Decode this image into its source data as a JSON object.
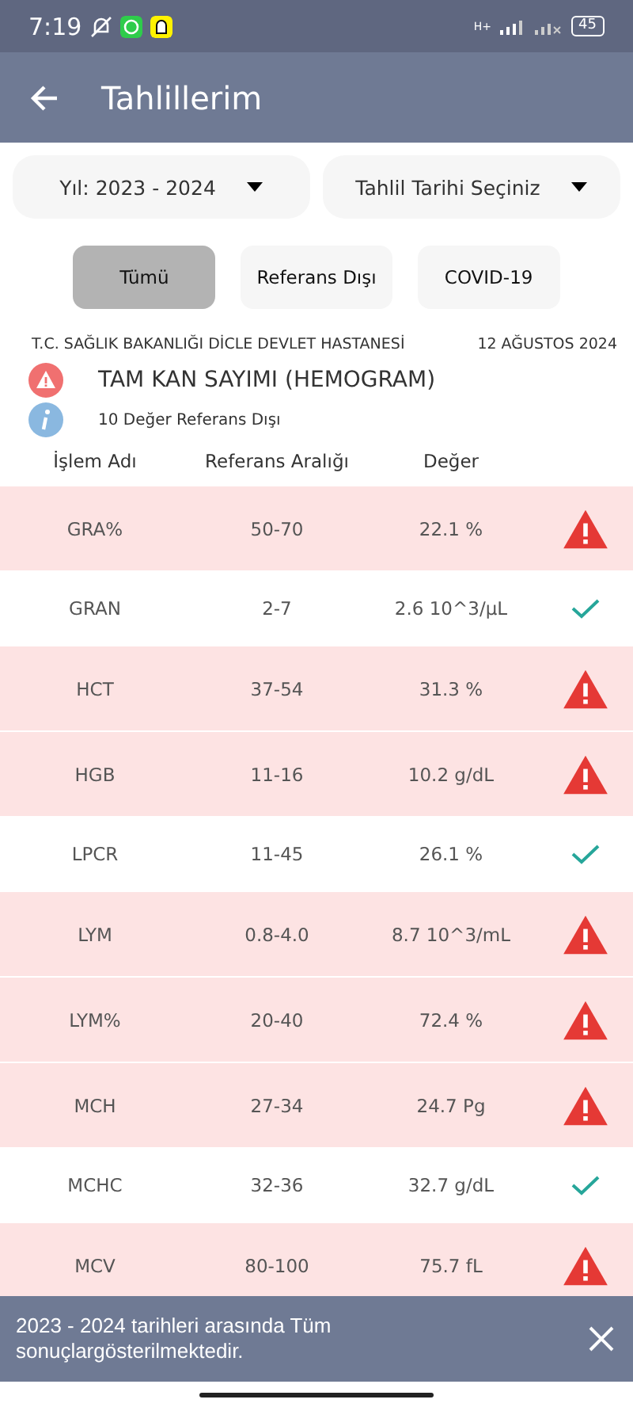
{
  "status_bar": {
    "time": "7:19",
    "network": "H+",
    "battery": "45"
  },
  "app_bar": {
    "title": "Tahlillerim"
  },
  "dropdowns": [
    {
      "value": "Yıl: 2023 - 2024"
    },
    {
      "value": "Tahlil Tarihi Seçiniz"
    }
  ],
  "filters": [
    {
      "label": "Tümü",
      "selected": true
    },
    {
      "label": "Referans Dışı",
      "selected": false
    },
    {
      "label": "COVID-19",
      "selected": false
    }
  ],
  "report": {
    "hospital": "T.C. SAĞLIK BAKANLIĞI DİCLE DEVLET HASTANESİ",
    "date": "12 AĞUSTOS 2024",
    "test_name": "TAM KAN SAYIMI (HEMOGRAM)",
    "summary": "10 Değer Referans Dışı"
  },
  "table": {
    "columns": [
      "İşlem Adı",
      "Referans Aralığı",
      "Değer"
    ],
    "rows": [
      {
        "name": "GRA%",
        "range": "50-70",
        "value": "22.1 %",
        "out_of_range": true
      },
      {
        "name": "GRAN",
        "range": "2-7",
        "value": "2.6 10^3/µL",
        "out_of_range": false
      },
      {
        "name": "HCT",
        "range": "37-54",
        "value": "31.3 %",
        "out_of_range": true
      },
      {
        "name": "HGB",
        "range": "11-16",
        "value": "10.2 g/dL",
        "out_of_range": true
      },
      {
        "name": "LPCR",
        "range": "11-45",
        "value": "26.1 %",
        "out_of_range": false
      },
      {
        "name": "LYM",
        "range": "0.8-4.0",
        "value": "8.7 10^3/mL",
        "out_of_range": true
      },
      {
        "name": "LYM%",
        "range": "20-40",
        "value": "72.4 %",
        "out_of_range": true
      },
      {
        "name": "MCH",
        "range": "27-34",
        "value": "24.7 Pg",
        "out_of_range": true
      },
      {
        "name": "MCHC",
        "range": "32-36",
        "value": "32.7 g/dL",
        "out_of_range": false
      },
      {
        "name": "MCV",
        "range": "80-100",
        "value": "75.7 fL",
        "out_of_range": true
      }
    ]
  },
  "snackbar": {
    "message": "2023 - 2024 tarihleri arasında Tüm sonuçlargösterilmektedir."
  }
}
